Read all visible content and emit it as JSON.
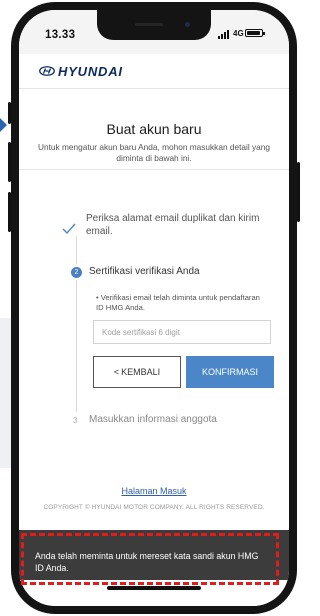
{
  "status_bar": {
    "time": "13.33",
    "network": "4G"
  },
  "header": {
    "logo_text": "HYUNDAI"
  },
  "page": {
    "title": "Buat akun baru",
    "subtitle": "Untuk mengatur akun baru Anda, mohon masukkan detail yang diminta di bawah ini."
  },
  "steps": [
    {
      "number": "1",
      "label": "Periksa alamat email duplikat dan kirim email.",
      "state": "done"
    },
    {
      "number": "2",
      "label": "Sertifikasi verifikasi Anda",
      "state": "active"
    },
    {
      "number": "3",
      "label": "Masukkan informasi anggota",
      "state": "pending"
    }
  ],
  "verification": {
    "note": "• Verifikasi email telah diminta untuk pendaftaran ID HMG Anda.",
    "code_placeholder": "Kode sertifikasi 6 digit",
    "code_value": "",
    "back_label": "KEMBALI",
    "confirm_label": "KONFIRMASI"
  },
  "footer": {
    "home_link": "Halaman Masuk",
    "copyright": "COPYRIGHT © HYUNDAI MOTOR COMPANY. ALL RIGHTS RESERVED."
  },
  "toast": {
    "message": "Anda telah meminta untuk mereset kata sandi akun HMG ID Anda."
  },
  "colors": {
    "accent": "#4a86c8",
    "brand": "#0a2a5e",
    "highlight": "#e31b1b",
    "toast_bg": "#3c3c3c"
  },
  "icons": {
    "step1": "check-icon",
    "back": "chevron-left-icon",
    "logo": "hyundai-emblem-icon"
  }
}
